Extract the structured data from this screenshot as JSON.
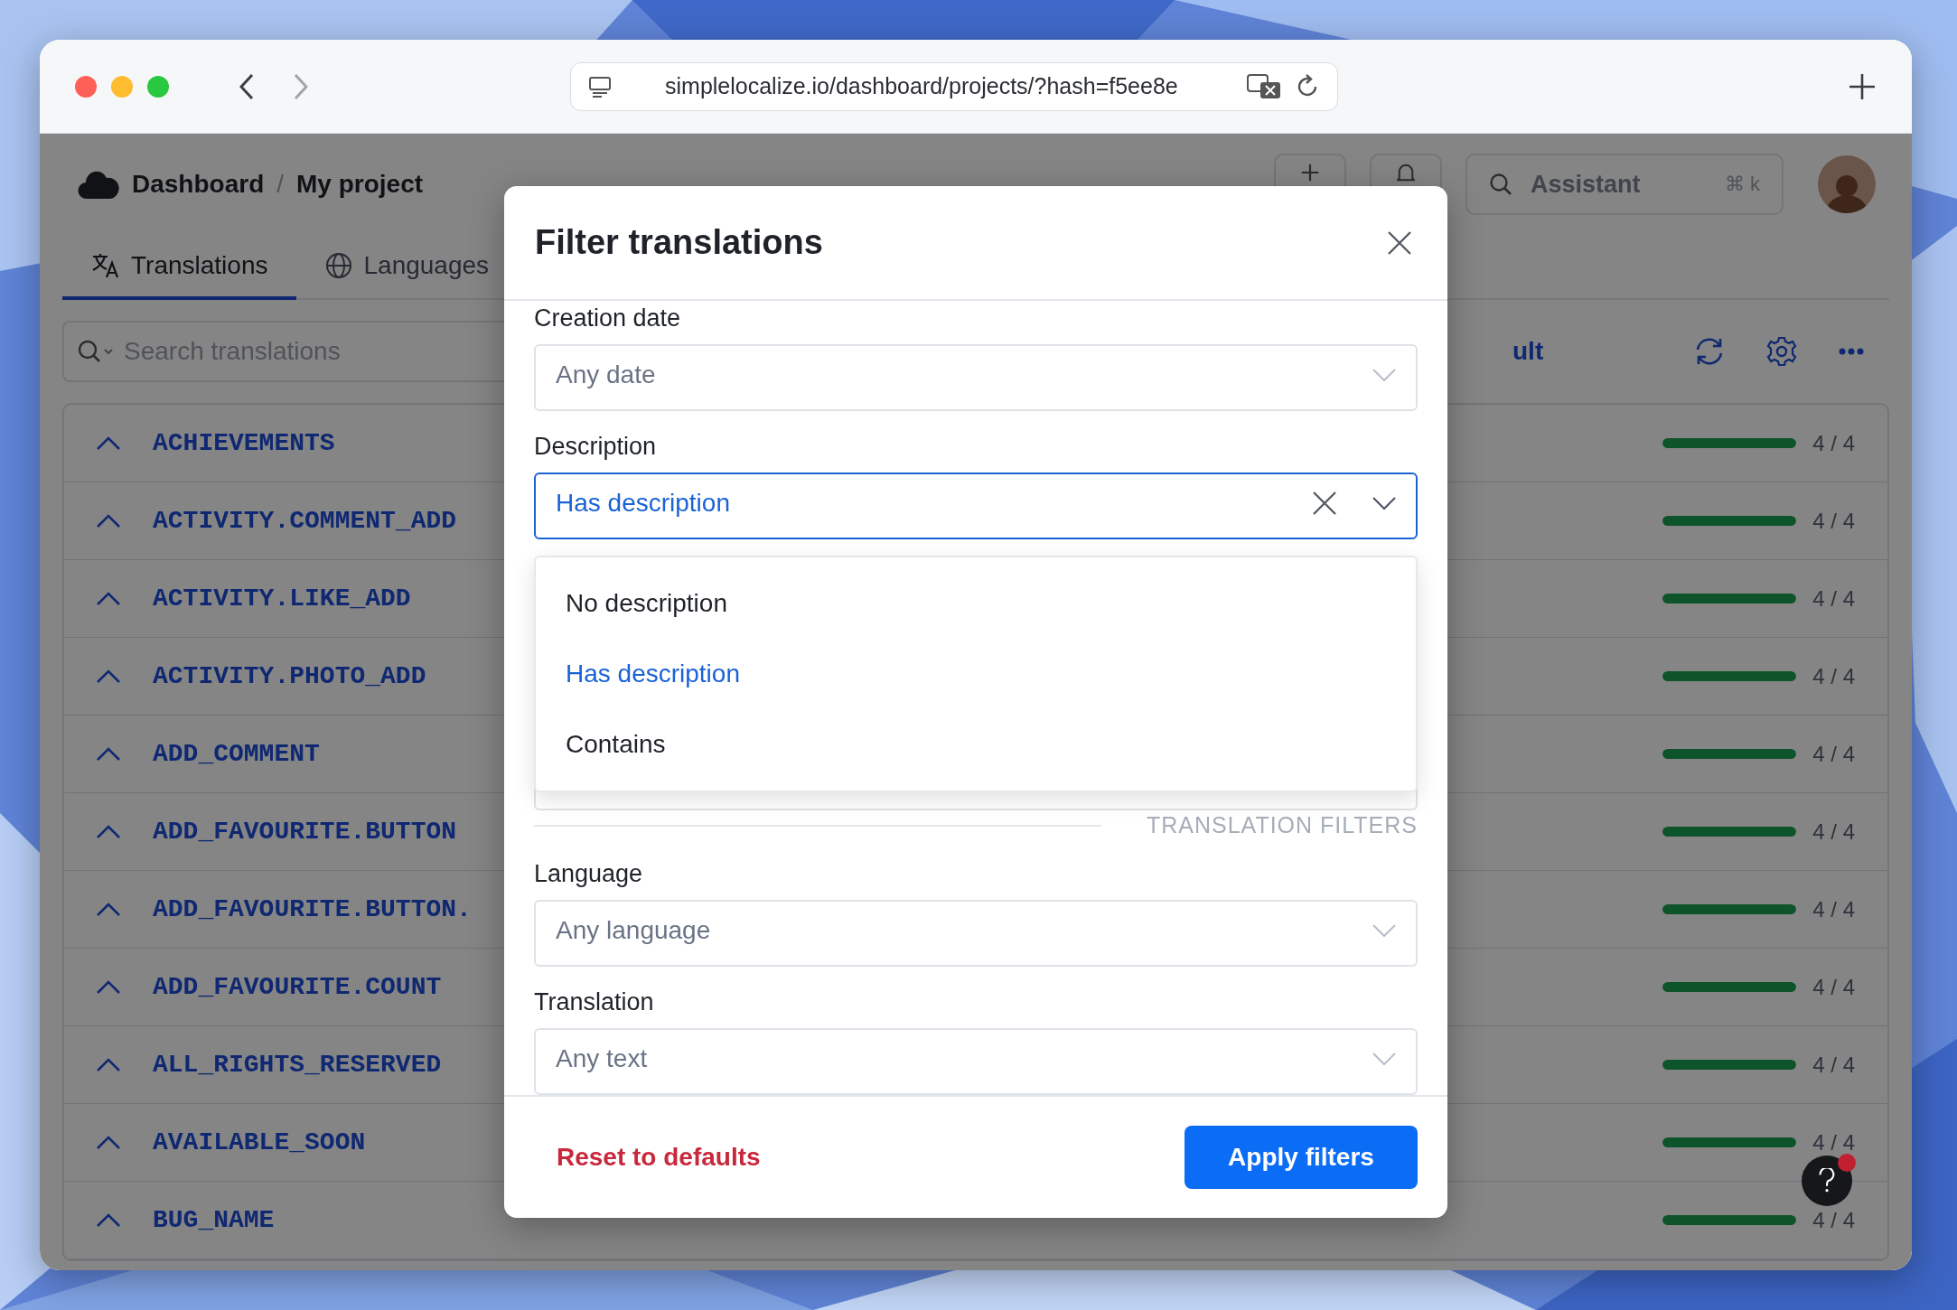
{
  "browser": {
    "url": "simplelocalize.io/dashboard/projects/?hash=f5ee8e"
  },
  "app": {
    "breadcrumb": [
      "Dashboard",
      "My project"
    ],
    "breadcrumb_separator": "/",
    "assistant": {
      "placeholder": "Assistant",
      "shortcut": "⌘ k"
    },
    "tabs": [
      {
        "label": "Translations",
        "selected": true
      },
      {
        "label": "Languages",
        "selected": false
      }
    ],
    "search": {
      "placeholder": "Search translations"
    },
    "toolbar_text": "ult",
    "keys": [
      {
        "key": "ACHIEVEMENTS",
        "count": "4 / 4",
        "level": 1
      },
      {
        "key": "ACTIVITY.COMMENT_ADD",
        "count": "4 / 4",
        "level": 1
      },
      {
        "key": "ACTIVITY.LIKE_ADD",
        "count": "4 / 4",
        "level": 1
      },
      {
        "key": "ACTIVITY.PHOTO_ADD",
        "count": "4 / 4",
        "level": 1
      },
      {
        "key": "ADD_COMMENT",
        "count": "4 / 4",
        "level": 1
      },
      {
        "key": "ADD_FAVOURITE.BUTTON",
        "count": "4 / 4",
        "level": 1
      },
      {
        "key": "ADD_FAVOURITE.BUTTON.",
        "count": "4 / 4",
        "level": 1
      },
      {
        "key": "ADD_FAVOURITE.COUNT",
        "count": "4 / 4",
        "level": 1
      },
      {
        "key": "ALL_RIGHTS_RESERVED",
        "count": "4 / 4",
        "level": 1
      },
      {
        "key": "AVAILABLE_SOON",
        "count": "4 / 4",
        "level": 1
      },
      {
        "key": "BUG_NAME",
        "count": "4 / 4",
        "level": 1
      }
    ]
  },
  "modal": {
    "title": "Filter translations",
    "fields": [
      {
        "label": "Creation date",
        "placeholder": "Any date",
        "open": false
      },
      {
        "label": "Description",
        "value": "Has description",
        "open": true,
        "options": [
          {
            "label": "No description",
            "selected": false
          },
          {
            "label": "Has description",
            "selected": true
          },
          {
            "label": "Contains",
            "selected": false
          }
        ]
      },
      {
        "kind": "section",
        "title": "TRANSLATION FILTERS"
      },
      {
        "label": "Language",
        "placeholder": "Any language",
        "open": false
      },
      {
        "label": "Translation",
        "placeholder": "Any text",
        "open": false
      }
    ],
    "reset": "Reset to defaults",
    "apply": "Apply filters"
  }
}
